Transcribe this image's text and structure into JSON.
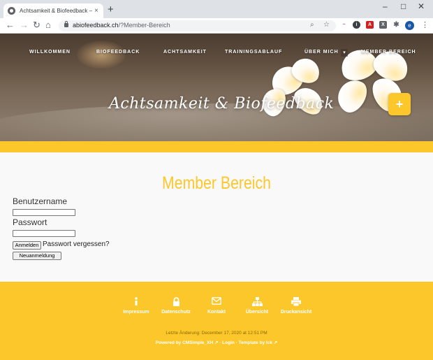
{
  "browser": {
    "tab_title": "Achtsamkeit & Biofeedback – Me",
    "tab_close": "×",
    "new_tab": "+",
    "url_host": "abiofeedback.ch",
    "url_path": "/?Member-Bereich",
    "profile_initial": "e"
  },
  "nav": {
    "items": [
      "WILLKOMMEN",
      "BIOFEEDBACK",
      "ACHTSAMKEIT",
      "TRAININGSABLAUF",
      "ÜBER MICH",
      "MEMBER BEREICH"
    ],
    "caret": "▾"
  },
  "hero": {
    "site_title": "Achtsamkeit & Biofeedback",
    "plus": "+"
  },
  "main": {
    "heading": "Member Bereich",
    "username_label": "Benutzername",
    "password_label": "Passwort",
    "login_button": "Anmelden",
    "forgot_text": "Passwort vergessen?",
    "register_button": "Neuanmeldung"
  },
  "footer": {
    "links": [
      {
        "label": "Impressum",
        "icon": "info-icon"
      },
      {
        "label": "Datenschutz",
        "icon": "lock-icon"
      },
      {
        "label": "Kontakt",
        "icon": "envelope-icon"
      },
      {
        "label": "Übersicht",
        "icon": "sitemap-icon"
      },
      {
        "label": "Druckansicht",
        "icon": "printer-icon"
      }
    ],
    "last_updated": "Letzte Änderung: December 17, 2020 at 12:51 PM",
    "powered_by": "Powered by CMSimple_XH ↗ · Login · Template by lck ↗"
  },
  "colors": {
    "accent": "#fcc72a",
    "text": "#333333"
  }
}
